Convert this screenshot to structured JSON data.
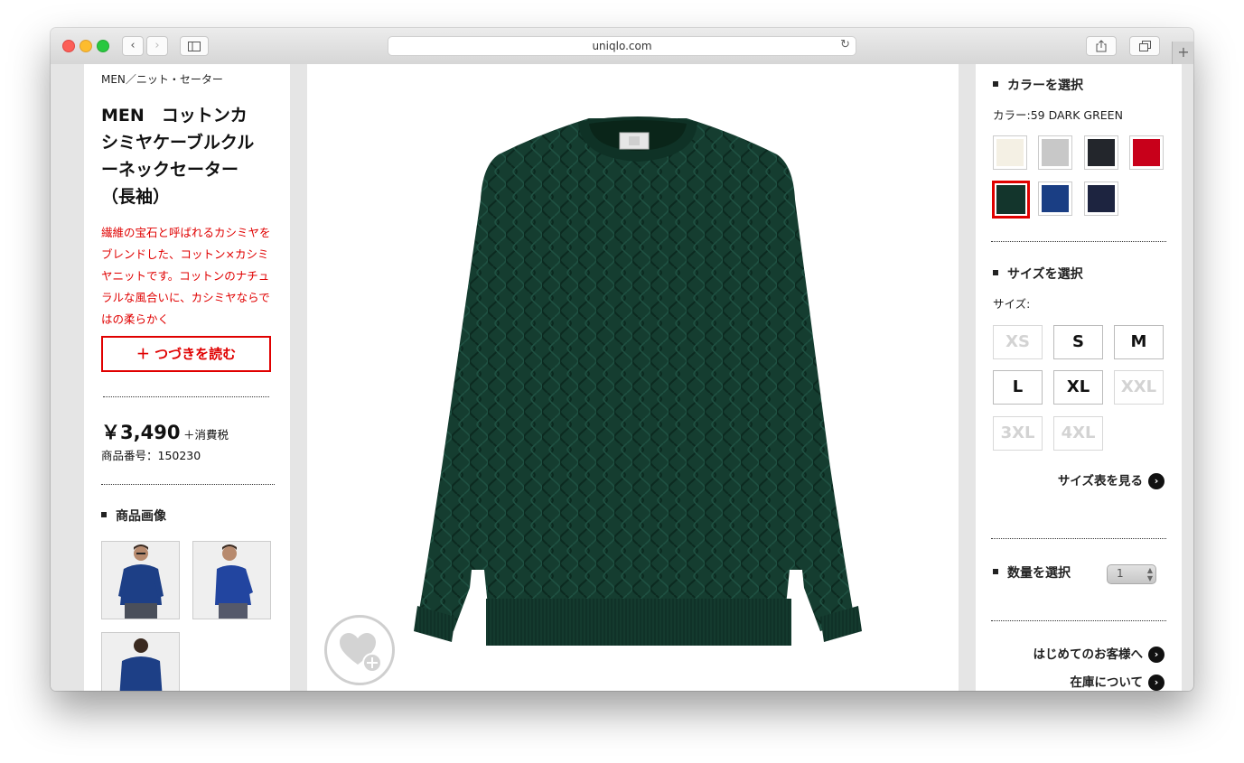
{
  "browser": {
    "url": "uniqlo.com",
    "back_icon": "‹",
    "forward_icon": "›",
    "reload_icon": "↻",
    "new_tab_icon": "+"
  },
  "product": {
    "breadcrumb": "MEN／ニット・セーター",
    "title": "MEN　コットンカ\nシミヤケーブルクル\nーネックセーター\n（長袖）",
    "description": "繊維の宝石と呼ばれるカシミヤをブレンドした、コットン×カシミヤニットです。コットンのナチュラルな風合いに、カシミヤならではの柔らかく",
    "read_more": "＋ つづきを読む",
    "price": "￥3,490",
    "tax_label": "＋消費税",
    "product_number": "商品番号：150230",
    "images_heading": "商品画像"
  },
  "color": {
    "heading": "カラーを選択",
    "selected_label": "カラー:59 DARK GREEN",
    "swatches": [
      {
        "name": "off-white",
        "color": "#f4f0e4"
      },
      {
        "name": "gray",
        "color": "#c8c8c8"
      },
      {
        "name": "black",
        "color": "#23262c"
      },
      {
        "name": "red",
        "color": "#c8001a"
      },
      {
        "name": "dark-green",
        "color": "#13352c"
      },
      {
        "name": "blue",
        "color": "#1a3e84"
      },
      {
        "name": "navy",
        "color": "#1d2440"
      }
    ],
    "selected_index": 4
  },
  "size": {
    "heading": "サイズを選択",
    "label": "サイズ:",
    "options": [
      {
        "label": "XS",
        "available": false
      },
      {
        "label": "S",
        "available": true
      },
      {
        "label": "M",
        "available": true
      },
      {
        "label": "L",
        "available": true
      },
      {
        "label": "XL",
        "available": true
      },
      {
        "label": "XXL",
        "available": false
      },
      {
        "label": "3XL",
        "available": false
      },
      {
        "label": "4XL",
        "available": false
      }
    ],
    "chart_link": "サイズ表を見る"
  },
  "quantity": {
    "heading": "数量を選択",
    "value": "1"
  },
  "links": {
    "first_time": "はじめてのお客様へ",
    "stock": "在庫について"
  },
  "colors": {
    "accent_red": "#e00000",
    "sweater": "#153d30"
  }
}
